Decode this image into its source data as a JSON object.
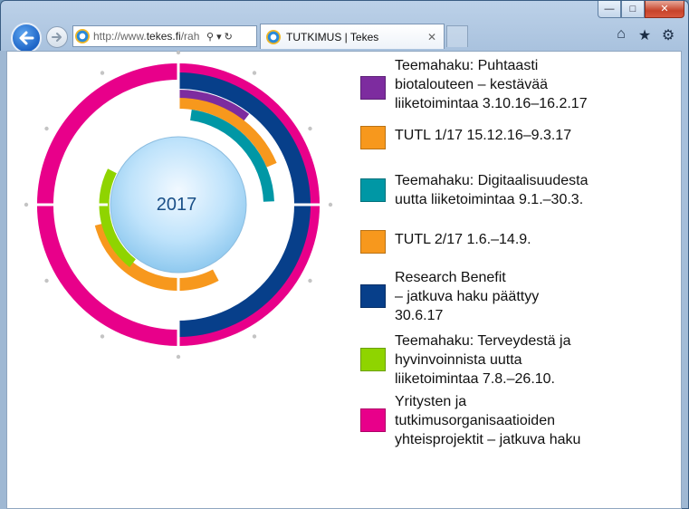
{
  "browser": {
    "address": {
      "prefix": "http://www.",
      "domain": "tekes.fi",
      "path": "/rah"
    },
    "tab": {
      "title": "TUTKIMUS | Tekes"
    },
    "icons": [
      "back-arrow-icon",
      "forward-arrow-icon",
      "search-icon",
      "dropdown-icon",
      "refresh-icon",
      "home-icon",
      "favorites-star-icon",
      "settings-gear-icon"
    ]
  },
  "chart_data": {
    "type": "radial-timeline",
    "center_label": "2017",
    "ring_colors": {
      "magenta": "#e8008a",
      "darkblue": "#073f8a",
      "purple": "#7d2c9f",
      "orange": "#f7981d",
      "teal": "#0097a5",
      "green": "#8fd400"
    }
  },
  "legend": [
    {
      "label": "Teemahaku: Puhtaasti\nbiotalouteen – kestävää\nliiketoimintaa 3.10.16–16.2.17",
      "color": "#7d2c9f"
    },
    {
      "label": "TUTL 1/17 15.12.16–9.3.17",
      "color": "#f7981d"
    },
    {
      "label": "Teemahaku: Digitaalisuudesta\nuutta liiketoimintaa 9.1.–30.3.",
      "color": "#0097a5"
    },
    {
      "label": "TUTL 2/17 1.6.–14.9.",
      "color": "#f7981d"
    },
    {
      "label": "Research Benefit\n– jatkuva haku päättyy\n30.6.17",
      "color": "#073f8a"
    },
    {
      "label": "Teemahaku: Terveydestä ja\nhyvinvoinnista uutta\nliiketoimintaa  7.8.–26.10.",
      "color": "#8fd400"
    },
    {
      "label": "Yritysten ja\ntutkimusorganisaatioiden\nyhteisprojektit – jatkuva haku",
      "color": "#e8008a"
    }
  ]
}
